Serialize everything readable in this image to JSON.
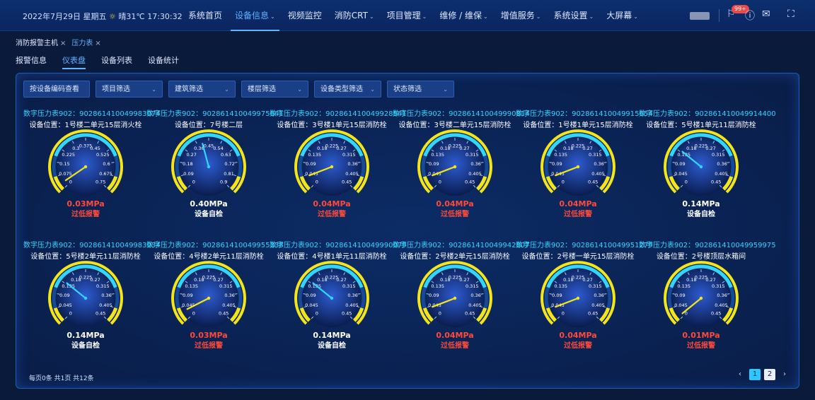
{
  "header": {
    "datetime": "2022年7月29日 星期五",
    "weather": "晴31℃",
    "time": "17:30:32",
    "badge": "99+",
    "nav": [
      {
        "label": "系统首页",
        "chev": false,
        "active": false
      },
      {
        "label": "设备信息",
        "chev": true,
        "active": true
      },
      {
        "label": "视频监控",
        "chev": false,
        "active": false
      },
      {
        "label": "消防CRT",
        "chev": true,
        "active": false
      },
      {
        "label": "项目管理",
        "chev": true,
        "active": false
      },
      {
        "label": "维修 / 维保",
        "chev": true,
        "active": false
      },
      {
        "label": "增值服务",
        "chev": true,
        "active": false
      },
      {
        "label": "系统设置",
        "chev": true,
        "active": false
      },
      {
        "label": "大屏幕",
        "chev": true,
        "active": false
      }
    ]
  },
  "tabs": [
    {
      "label": "消防报警主机",
      "active": false
    },
    {
      "label": "压力表",
      "active": true
    }
  ],
  "subtabs": [
    {
      "label": "报警信息",
      "active": false
    },
    {
      "label": "仪表盘",
      "active": true
    },
    {
      "label": "设备列表",
      "active": false
    },
    {
      "label": "设备统计",
      "active": false
    }
  ],
  "filters": {
    "button": "按设备编码查看",
    "selects": [
      "项目筛选",
      "建筑筛选",
      "楼层筛选",
      "设备类型筛选",
      "状态筛选"
    ]
  },
  "gauges": [
    {
      "code": "数字压力表902：902861410049983074",
      "loc": "设备位置：1号楼二单元15层消火栓",
      "ticks": [
        "0",
        "0.075",
        "0.15",
        "0.225",
        "0.3",
        "0.375",
        "0.45",
        "0.525",
        "0.6",
        "0.675",
        "0.75"
      ],
      "value": 0.03,
      "max": 0.75,
      "valueText": "0.03MPa",
      "status": "过低报警",
      "alarm": true
    },
    {
      "code": "数字压力表902：902861410049975641",
      "loc": "设备位置：7号楼二层",
      "ticks": [
        "0",
        "0.09",
        "0.18",
        "0.27",
        "0.36",
        "0.45",
        "0.54",
        "0.63",
        "0.72",
        "0.81",
        "0.9"
      ],
      "value": 0.4,
      "max": 0.9,
      "valueText": "0.40MPa",
      "status": "设备自检",
      "alarm": false
    },
    {
      "code": "数字压力表902：902861410049928541",
      "loc": "设备位置：3号楼1单元15层消防栓",
      "ticks": [
        "0",
        "0.045",
        "0.09",
        "0.135",
        "0.18",
        "0.225",
        "0.27",
        "0.315",
        "0.36",
        "0.405",
        "0.45"
      ],
      "value": 0.04,
      "max": 0.45,
      "valueText": "0.04MPa",
      "status": "过低报警",
      "alarm": true
    },
    {
      "code": "数字压力表902：902861410049990814",
      "loc": "设备位置：3号楼二单元15层消防栓",
      "ticks": [
        "0",
        "0.045",
        "0.09",
        "0.135",
        "0.18",
        "0.225",
        "0.27",
        "0.315",
        "0.36",
        "0.405",
        "0.45"
      ],
      "value": 0.04,
      "max": 0.45,
      "valueText": "0.04MPa",
      "status": "过低报警",
      "alarm": true
    },
    {
      "code": "数字压力表902：902861410049915654",
      "loc": "设备位置：1号楼1单元15层消防栓",
      "ticks": [
        "0",
        "0.045",
        "0.09",
        "0.135",
        "0.18",
        "0.225",
        "0.27",
        "0.315",
        "0.36",
        "0.405",
        "0.45"
      ],
      "value": 0.04,
      "max": 0.45,
      "valueText": "0.04MPa",
      "status": "过低报警",
      "alarm": true
    },
    {
      "code": "数字压力表902：902861410049914400",
      "loc": "设备位置：5号楼1单元11层消防栓",
      "ticks": [
        "0",
        "0.045",
        "0.09",
        "0.135",
        "0.18",
        "0.225",
        "0.27",
        "0.315",
        "0.36",
        "0.405",
        "0.45"
      ],
      "value": 0.14,
      "max": 0.45,
      "valueText": "0.14MPa",
      "status": "设备自检",
      "alarm": false
    },
    {
      "code": "数字压力表902：902861410049983934",
      "loc": "设备位置：5号楼2单元11层消防栓",
      "ticks": [
        "0",
        "0.045",
        "0.09",
        "0.135",
        "0.18",
        "0.225",
        "0.27",
        "0.315",
        "0.36",
        "0.405",
        "0.45"
      ],
      "value": 0.14,
      "max": 0.45,
      "valueText": "0.14MPa",
      "status": "设备自检",
      "alarm": false
    },
    {
      "code": "数字压力表902：902861410049955338",
      "loc": "设备位置：4号楼2单元11层消防栓",
      "ticks": [
        "0",
        "0.045",
        "0.09",
        "0.135",
        "0.18",
        "0.225",
        "0.27",
        "0.315",
        "0.36",
        "0.405",
        "0.45"
      ],
      "value": 0.03,
      "max": 0.45,
      "valueText": "0.03MPa",
      "status": "过低报警",
      "alarm": true
    },
    {
      "code": "数字压力表902：902861410049990079",
      "loc": "设备位置：4号楼1单元11层消防栓",
      "ticks": [
        "0",
        "0.045",
        "0.09",
        "0.135",
        "0.18",
        "0.225",
        "0.27",
        "0.315",
        "0.36",
        "0.405",
        "0.45"
      ],
      "value": 0.14,
      "max": 0.45,
      "valueText": "0.14MPa",
      "status": "设备自检",
      "alarm": false
    },
    {
      "code": "数字压力表902：902861410049942807",
      "loc": "设备位置：2号楼2单元15层消防栓",
      "ticks": [
        "0",
        "0.045",
        "0.09",
        "0.135",
        "0.18",
        "0.225",
        "0.27",
        "0.315",
        "0.36",
        "0.405",
        "0.45"
      ],
      "value": 0.04,
      "max": 0.45,
      "valueText": "0.04MPa",
      "status": "过低报警",
      "alarm": true
    },
    {
      "code": "数字压力表902：902861410049951279",
      "loc": "设备位置：2号楼一单元15层消防栓",
      "ticks": [
        "0",
        "0.045",
        "0.09",
        "0.135",
        "0.18",
        "0.225",
        "0.27",
        "0.315",
        "0.36",
        "0.405",
        "0.45"
      ],
      "value": 0.04,
      "max": 0.45,
      "valueText": "0.04MPa",
      "status": "过低报警",
      "alarm": true
    },
    {
      "code": "数字压力表902：902861410049959975",
      "loc": "设备位置：2号楼顶层水箱间",
      "ticks": [
        "0",
        "0.045",
        "0.09",
        "0.135",
        "0.18",
        "0.225",
        "0.27",
        "0.315",
        "0.36",
        "0.405",
        "0.45"
      ],
      "value": 0.01,
      "max": 0.45,
      "valueText": "0.01MPa",
      "status": "过低报警",
      "alarm": true
    }
  ],
  "footer": {
    "summary": "每页0条  共1页  共12条",
    "pages": [
      "1",
      "2"
    ],
    "current": "1",
    "prev": "‹",
    "next": "›"
  },
  "colors": {
    "cyan": "#31d6ff",
    "yellow": "#f4e51a",
    "alarm": "#ff4a3a"
  }
}
